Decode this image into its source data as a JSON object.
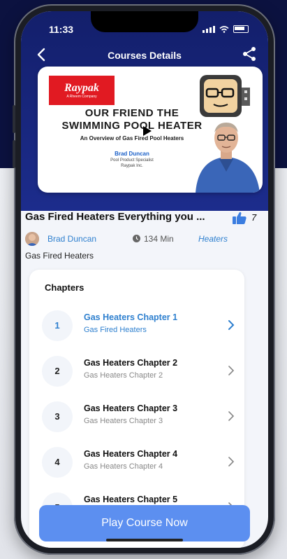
{
  "status_bar": {
    "time": "11:33"
  },
  "nav": {
    "title": "Courses Details",
    "back_icon": "chevron-left-icon",
    "share_icon": "share-icon"
  },
  "video": {
    "logo": "Raypak",
    "logo_sub": "A Rheem Company",
    "title_line1": "OUR FRIEND THE",
    "title_line2": "SWIMMING POOL HEATER",
    "subtitle": "An Overview of Gas Fired Pool Heaters",
    "presenter": "Brad Duncan",
    "presenter_role_1": "Pool Product Specialist",
    "presenter_role_2": "Raypak Inc."
  },
  "course": {
    "title": "Gas Fired Heaters Everything you ...",
    "likes": "7",
    "author": "Brad Duncan",
    "duration": "134 Min",
    "category": "Heaters",
    "category_label": "Gas Fired Heaters"
  },
  "chapters": {
    "heading": "Chapters",
    "items": [
      {
        "number": "1",
        "title": "Gas Heaters Chapter 1",
        "subtitle": "Gas Fired Heaters",
        "active": true
      },
      {
        "number": "2",
        "title": "Gas Heaters Chapter 2",
        "subtitle": "Gas Heaters Chapter 2",
        "active": false
      },
      {
        "number": "3",
        "title": "Gas Heaters Chapter 3",
        "subtitle": "Gas Heaters Chapter 3",
        "active": false
      },
      {
        "number": "4",
        "title": "Gas Heaters Chapter 4",
        "subtitle": "Gas Heaters Chapter 4",
        "active": false
      },
      {
        "number": "5",
        "title": "Gas Heaters Chapter 5",
        "subtitle": "",
        "active": false
      }
    ]
  },
  "cta": {
    "play_label": "Play Course Now"
  },
  "colors": {
    "header": "#1c2c8c",
    "accent": "#2f80cf",
    "cta": "#5c8ff0"
  }
}
